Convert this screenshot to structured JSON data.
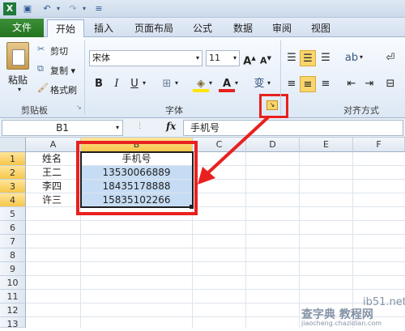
{
  "quick_access": {
    "icons": [
      "excel-icon",
      "save-icon",
      "undo-icon",
      "redo-icon",
      "customize-icon"
    ]
  },
  "tabs": {
    "file": "文件",
    "items": [
      "开始",
      "插入",
      "页面布局",
      "公式",
      "数据",
      "审阅",
      "视图"
    ],
    "active": "开始"
  },
  "ribbon": {
    "clipboard": {
      "paste": "粘贴",
      "cut": "剪切",
      "copy": "复制 ▾",
      "format_painter": "格式刷",
      "group": "剪贴板"
    },
    "font": {
      "name": "宋体",
      "size": "11",
      "bold": "B",
      "italic": "I",
      "underline": "U",
      "group": "字体"
    },
    "alignment": {
      "group": "对齐方式"
    }
  },
  "formula_bar": {
    "name_box": "B1",
    "fx": "fx",
    "value": "手机号"
  },
  "grid": {
    "columns": [
      "A",
      "B",
      "C",
      "D",
      "E",
      "F"
    ],
    "selected_column": "B",
    "rows": [
      "1",
      "2",
      "3",
      "4",
      "5",
      "6",
      "7",
      "8",
      "9",
      "10",
      "11",
      "12",
      "13"
    ],
    "cells": [
      {
        "a": "姓名",
        "b": "手机号"
      },
      {
        "a": "王二",
        "b": "13530066889"
      },
      {
        "a": "李四",
        "b": "18435178888"
      },
      {
        "a": "许三",
        "b": "15835102266"
      }
    ]
  },
  "watermark": {
    "line1": "ib51.net",
    "line2": "查字典 教程网",
    "line3": "jiaocheng.chazidian.com"
  },
  "colors": {
    "highlight_red": "#e8211f",
    "selection_blue": "#c6dcf4",
    "file_tab_green": "#2e7d2a"
  }
}
